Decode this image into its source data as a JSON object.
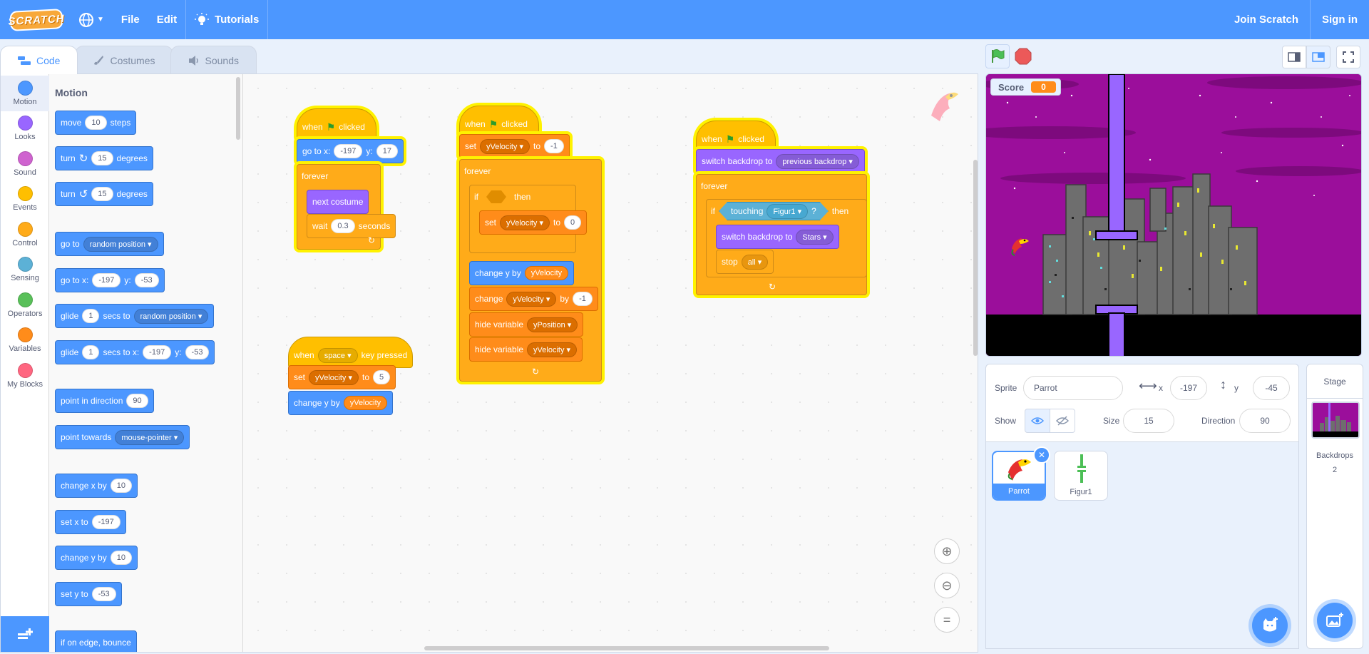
{
  "menubar": {
    "logo": "SCRATCH",
    "file": "File",
    "edit": "Edit",
    "tutorials": "Tutorials",
    "join": "Join Scratch",
    "signin": "Sign in"
  },
  "tabs": {
    "code": "Code",
    "costumes": "Costumes",
    "sounds": "Sounds"
  },
  "categories": [
    {
      "label": "Motion",
      "color": "#4c97ff"
    },
    {
      "label": "Looks",
      "color": "#9966ff"
    },
    {
      "label": "Sound",
      "color": "#cf63cf"
    },
    {
      "label": "Events",
      "color": "#ffbf00"
    },
    {
      "label": "Control",
      "color": "#ffab19"
    },
    {
      "label": "Sensing",
      "color": "#5cb1d6"
    },
    {
      "label": "Operators",
      "color": "#59c059"
    },
    {
      "label": "Variables",
      "color": "#ff8c1a"
    },
    {
      "label": "My Blocks",
      "color": "#ff6680"
    }
  ],
  "palette": {
    "title": "Motion",
    "move": {
      "a": "move",
      "n": "10",
      "b": "steps"
    },
    "turn_r": {
      "a": "turn",
      "n": "15",
      "b": "degrees"
    },
    "turn_l": {
      "a": "turn",
      "n": "15",
      "b": "degrees"
    },
    "goto": {
      "a": "go to",
      "dd": "random position"
    },
    "gotoxy": {
      "a": "go to x:",
      "x": "-197",
      "b": "y:",
      "y": "-53"
    },
    "glide1": {
      "a": "glide",
      "n": "1",
      "b": "secs to",
      "dd": "random position"
    },
    "glide2": {
      "a": "glide",
      "n": "1",
      "b": "secs to x:",
      "x": "-197",
      "c": "y:",
      "y": "-53"
    },
    "pointdir": {
      "a": "point in direction",
      "n": "90"
    },
    "pointtow": {
      "a": "point towards",
      "dd": "mouse-pointer"
    },
    "changex": {
      "a": "change x by",
      "n": "10"
    },
    "setx": {
      "a": "set x to",
      "n": "-197"
    },
    "changey": {
      "a": "change y by",
      "n": "10"
    },
    "sety": {
      "a": "set y to",
      "n": "-53"
    },
    "bounce": {
      "a": "if on edge, bounce"
    }
  },
  "script1": {
    "when": "when",
    "clicked": "clicked",
    "goto": "go to x:",
    "x": "-197",
    "y_lbl": "y:",
    "y": "17",
    "forever": "forever",
    "next": "next costume",
    "wait": "wait",
    "wait_n": "0.3",
    "seconds": "seconds"
  },
  "script2": {
    "when": "when",
    "clicked": "clicked",
    "set": "set",
    "var": "yVelocity",
    "to": "to",
    "val": "-1",
    "forever": "forever",
    "if": "if",
    "then": "then",
    "set2": "set",
    "var2": "yVelocity",
    "to2": "to",
    "val2": "0",
    "changey": "change y by",
    "rep": "yVelocity",
    "change": "change",
    "var3": "yVelocity",
    "by": "by",
    "val3": "-1",
    "hide1": "hide variable",
    "hv1": "yPosition",
    "hide2": "hide variable",
    "hv2": "yVelocity"
  },
  "script3": {
    "when": "when",
    "clicked": "clicked",
    "switch": "switch backdrop to",
    "bd": "previous backdrop",
    "forever": "forever",
    "if": "if",
    "touching": "touching",
    "obj": "Figur1",
    "q": "?",
    "then": "then",
    "switch2": "switch backdrop to",
    "bd2": "Stars",
    "stop": "stop",
    "stopdd": "all"
  },
  "script4": {
    "when": "when",
    "key": "space",
    "pressed": "key pressed",
    "set": "set",
    "var": "yVelocity",
    "to": "to",
    "val": "5",
    "changey": "change y by",
    "rep": "yVelocity"
  },
  "stage": {
    "score_label": "Score",
    "score_value": "0"
  },
  "sprite": {
    "sprite_label": "Sprite",
    "name": "Parrot",
    "x_label": "x",
    "x": "-197",
    "y_label": "y",
    "y": "-45",
    "show_label": "Show",
    "size_label": "Size",
    "size": "15",
    "dir_label": "Direction",
    "direction": "90"
  },
  "sprites": [
    {
      "name": "Parrot"
    },
    {
      "name": "Figur1"
    }
  ],
  "stage_panel": {
    "title": "Stage",
    "backdrops_label": "Backdrops",
    "backdrops_count": "2"
  }
}
